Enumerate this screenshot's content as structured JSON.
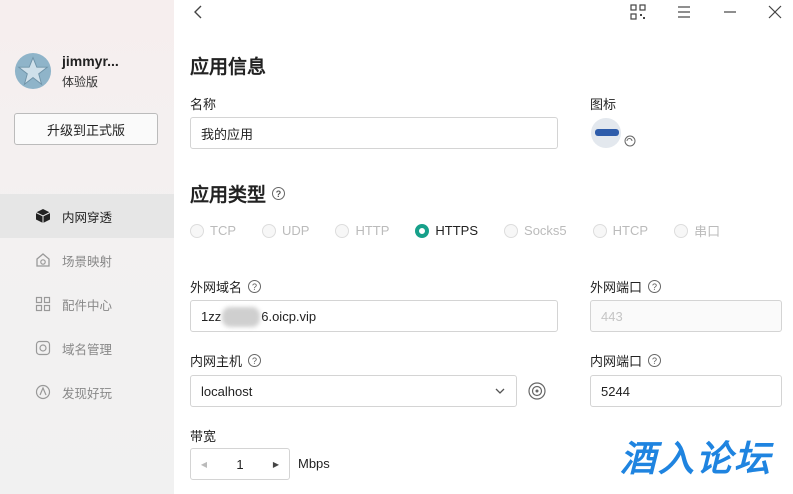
{
  "sidebar": {
    "username": "jimmyr...",
    "plan": "体验版",
    "upgrade_label": "升级到正式版",
    "nav": [
      {
        "label": "内网穿透",
        "icon": "cube-icon",
        "active": true
      },
      {
        "label": "场景映射",
        "icon": "scene-icon",
        "active": false
      },
      {
        "label": "配件中心",
        "icon": "grid-icon",
        "active": false
      },
      {
        "label": "域名管理",
        "icon": "domain-icon",
        "active": false
      },
      {
        "label": "发现好玩",
        "icon": "discover-icon",
        "active": false
      }
    ]
  },
  "app_info": {
    "heading": "应用信息",
    "name_label": "名称",
    "name_value": "我的应用",
    "icon_label": "图标"
  },
  "app_type": {
    "heading": "应用类型",
    "options": [
      "TCP",
      "UDP",
      "HTTP",
      "HTTPS",
      "Socks5",
      "HTCP",
      "串口"
    ],
    "selected": "HTTPS"
  },
  "external": {
    "domain_label": "外网域名",
    "domain_value_prefix": "1zz",
    "domain_value_suffix": "6.oicp.vip",
    "port_label": "外网端口",
    "port_placeholder": "443"
  },
  "internal": {
    "host_label": "内网主机",
    "host_value": "localhost",
    "port_label": "内网端口",
    "port_value": "5244"
  },
  "bandwidth": {
    "label": "带宽",
    "value": "1",
    "unit": "Mbps"
  },
  "watermark": "酒入论坛",
  "colors": {
    "accent": "#17a08a",
    "watermark": "#1f84e0"
  }
}
